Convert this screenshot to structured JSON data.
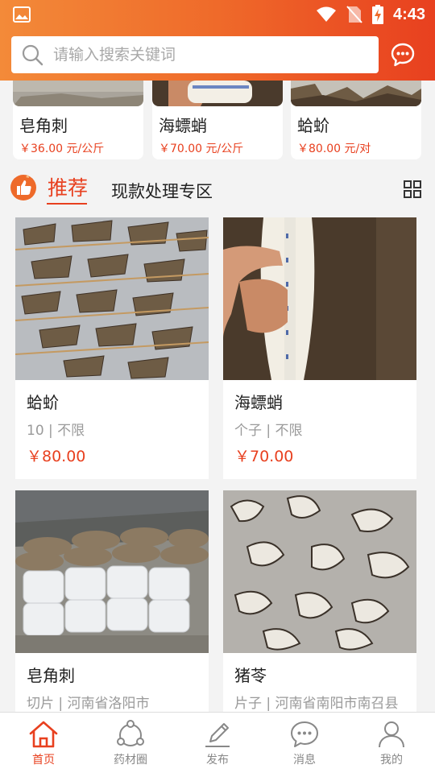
{
  "status": {
    "time": "4:43"
  },
  "search": {
    "placeholder": "请输入搜索关键词"
  },
  "top_products": [
    {
      "name": "皂角刺",
      "price": "￥36.00 元/公斤"
    },
    {
      "name": "海螵蛸",
      "price": "￥70.00 元/公斤"
    },
    {
      "name": "蛤蚧",
      "price": "￥80.00 元/对"
    }
  ],
  "tabs": {
    "recommend": "推荐",
    "clearance": "现款处理专区"
  },
  "products": [
    {
      "name": "蛤蚧",
      "spec": "10 | 不限",
      "price": "￥80.00"
    },
    {
      "name": "海螵蛸",
      "spec": "个子 | 不限",
      "price": "￥70.00"
    },
    {
      "name": "皂角刺",
      "spec": "切片 | 河南省洛阳市",
      "price": ""
    },
    {
      "name": "猪苓",
      "spec": "片子 | 河南省南阳市南召县",
      "price": ""
    }
  ],
  "nav": [
    {
      "label": "首页",
      "icon": "home-icon",
      "active": true
    },
    {
      "label": "药材圈",
      "icon": "share-circle-icon",
      "active": false
    },
    {
      "label": "发布",
      "icon": "pencil-icon",
      "active": false
    },
    {
      "label": "消息",
      "icon": "message-icon",
      "active": false
    },
    {
      "label": "我的",
      "icon": "user-icon",
      "active": false
    }
  ],
  "colors": {
    "accent": "#e8401f",
    "header_start": "#f38a39",
    "header_end": "#e8401f"
  }
}
